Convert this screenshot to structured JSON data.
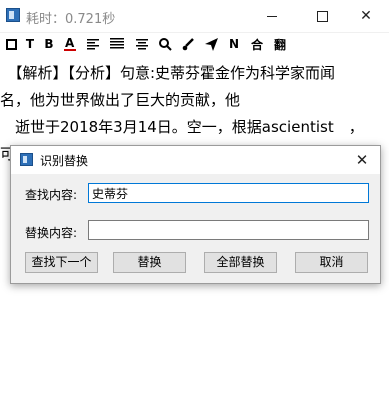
{
  "window": {
    "title": "耗时：0.721秒",
    "minimize_label": "—",
    "maximize_label": "☐",
    "close_label": "✕"
  },
  "toolbar": {
    "items": [
      "□",
      "T",
      "B",
      "A",
      "≡",
      "≣",
      "≣",
      "🔍",
      "🖌",
      "➤",
      "N",
      "合",
      "翻"
    ],
    "accent_color": "#cc0000"
  },
  "editor": {
    "lines": [
      "　【解析】【分析】句意:史蒂芬霍金作为科学家而闻",
      "名，他为世界做出了巨大的贡献，他",
      "　逝世于2018年3月14日。空一，根据ascientist　，",
      "可"
    ]
  },
  "dialog": {
    "title": "识别替换",
    "close_label": "✕",
    "find_label": "查找内容:",
    "find_value": "史蒂芬",
    "replace_label": "替换内容:",
    "replace_value": "",
    "buttons": {
      "find_next": "查找下一个",
      "replace": "替换",
      "replace_all": "全部替换",
      "cancel": "取消"
    }
  }
}
